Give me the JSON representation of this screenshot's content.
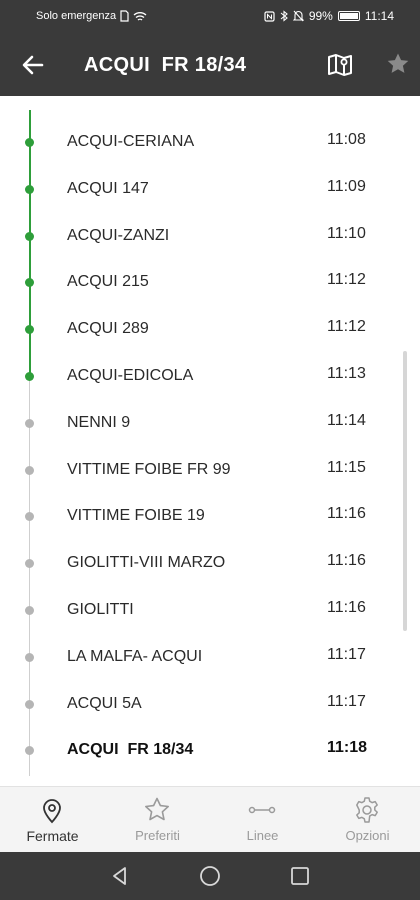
{
  "status_bar": {
    "left_text": "Solo emergenza",
    "battery_percent": "99%",
    "battery_level": 0.99,
    "time": "11:14",
    "icons": [
      "sim-icon",
      "wifi-icon",
      "nfc-icon",
      "bluetooth-icon",
      "mute-icon",
      "battery-icon"
    ]
  },
  "header": {
    "title": "ACQUI  FR 18/34",
    "icons": [
      "back-arrow-icon",
      "map-icon",
      "star-icon"
    ]
  },
  "colors": {
    "bar_background": "#3a3a3a",
    "passed_accent": "#2e9e3a",
    "upcoming_dot": "#b5b5b5"
  },
  "stops": [
    {
      "name": "ACQUI-CERIANA",
      "time": "11:08",
      "status": "passed"
    },
    {
      "name": "ACQUI 147",
      "time": "11:09",
      "status": "passed"
    },
    {
      "name": "ACQUI-ZANZI",
      "time": "11:10",
      "status": "passed"
    },
    {
      "name": "ACQUI 215",
      "time": "11:12",
      "status": "passed"
    },
    {
      "name": "ACQUI 289",
      "time": "11:12",
      "status": "passed"
    },
    {
      "name": "ACQUI-EDICOLA",
      "time": "11:13",
      "status": "passed"
    },
    {
      "name": "NENNI 9",
      "time": "11:14",
      "status": "upcoming"
    },
    {
      "name": "VITTIME FOIBE FR 99",
      "time": "11:15",
      "status": "upcoming"
    },
    {
      "name": "VITTIME FOIBE 19",
      "time": "11:16",
      "status": "upcoming"
    },
    {
      "name": "GIOLITTI-VIII MARZO",
      "time": "11:16",
      "status": "upcoming"
    },
    {
      "name": "GIOLITTI",
      "time": "11:16",
      "status": "upcoming"
    },
    {
      "name": "LA MALFA- ACQUI",
      "time": "11:17",
      "status": "upcoming"
    },
    {
      "name": "ACQUI 5A",
      "time": "11:17",
      "status": "upcoming"
    },
    {
      "name": "ACQUI  FR 18/34",
      "time": "11:18",
      "status": "current"
    }
  ],
  "bottom_nav": {
    "items": [
      {
        "label": "Fermate",
        "icon": "location-pin-icon",
        "active": true
      },
      {
        "label": "Preferiti",
        "icon": "star-outline-icon",
        "active": false
      },
      {
        "label": "Linee",
        "icon": "route-line-icon",
        "active": false
      },
      {
        "label": "Opzioni",
        "icon": "gear-icon",
        "active": false
      }
    ]
  },
  "system_nav": {
    "icons": [
      "back-triangle-icon",
      "home-circle-icon",
      "recents-square-icon"
    ]
  }
}
